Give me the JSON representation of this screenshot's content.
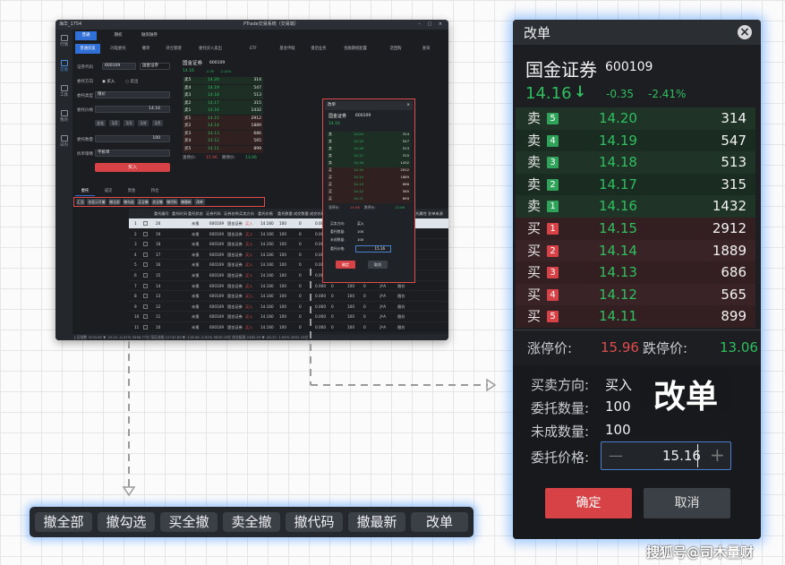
{
  "mini_window": {
    "title": "PTrade交易系统（交易端）",
    "user": "海华_1754",
    "nav": [
      "行情",
      "交易",
      "工具",
      "我的",
      "日内"
    ],
    "top_tabs": [
      "普通",
      "期权",
      "融资融券"
    ],
    "sub_tabs": [
      "普通买卖",
      "闪电委托",
      "撤单",
      "持仓管理",
      "委托买入卖出",
      "ETF",
      "基金申赎",
      "盘后业务",
      "金融期权配置",
      "逆回购",
      "查询"
    ],
    "form": {
      "code_label": "证券代码",
      "code_value": "600109",
      "name_value": "国金证券",
      "direction_label": "委托方向",
      "buy_option": "买入",
      "sell_option": "卖出",
      "type_label": "委托类型",
      "type_value": "限价",
      "price_label": "委托价格",
      "price_value": "14.16",
      "qty_label": "委托数量",
      "qty_value": "100",
      "strategy_label": "拆单策略",
      "strategy_value": "不拆单",
      "fractions": [
        "全仓",
        "1/2",
        "1/3",
        "1/4",
        "1/5"
      ],
      "submit_label": "买入"
    },
    "quote": {
      "name": "国金证券",
      "code": "600109",
      "price": "14.16",
      "change": "-0.35",
      "pct": "-2.41%",
      "sell_rows": [
        {
          "side": "卖5",
          "price": "14.20",
          "vol": "314"
        },
        {
          "side": "卖4",
          "price": "14.19",
          "vol": "547"
        },
        {
          "side": "卖3",
          "price": "14.18",
          "vol": "513"
        },
        {
          "side": "卖2",
          "price": "14.17",
          "vol": "315"
        },
        {
          "side": "卖1",
          "price": "14.16",
          "vol": "1432"
        }
      ],
      "buy_rows": [
        {
          "side": "买1",
          "price": "14.15",
          "vol": "2912"
        },
        {
          "side": "买2",
          "price": "14.14",
          "vol": "1889"
        },
        {
          "side": "买3",
          "price": "14.13",
          "vol": "686"
        },
        {
          "side": "买4",
          "price": "14.12",
          "vol": "565"
        },
        {
          "side": "买5",
          "price": "14.11",
          "vol": "899"
        }
      ],
      "limit_up_label": "涨停价:",
      "limit_up": "15.96",
      "limit_down_label": "跌停价:",
      "limit_down": "13.06"
    },
    "bottom_tabs": [
      "委托",
      "成交",
      "资金",
      "持仓"
    ],
    "toolbar": [
      "汇总",
      "仅显示可撤",
      "撤全部",
      "撤勾选",
      "买全撤",
      "卖全撤",
      "撤代码",
      "撤最新",
      "改单"
    ],
    "columns": [
      "委托编号",
      "委托时间",
      "委托状态",
      "证券代码",
      "证券名称",
      "买卖方向",
      "委托价格",
      "委托数量",
      "成交数量",
      "成交价格",
      "撤单数量",
      "未成数量",
      "撤单原因",
      "挂单数量",
      "证券市场",
      "委托属性",
      "发单来源"
    ],
    "orders": [
      {
        "no": "1",
        "id": "20",
        "status": "未报",
        "code": "600109",
        "name": "国金证券",
        "dir": "买入",
        "price": "14.160",
        "qty": "100",
        "filled": "0",
        "fprice": "0.000",
        "cancel": "0",
        "rest": "100",
        "pending": "0",
        "market": "沪A",
        "attr": "限价"
      },
      {
        "no": "2",
        "id": "19",
        "status": "未报",
        "code": "600109",
        "name": "国金证券",
        "dir": "买入",
        "price": "14.160",
        "qty": "100",
        "filled": "0",
        "fprice": "0.000",
        "cancel": "0",
        "rest": "100",
        "pending": "0",
        "market": "沪A",
        "attr": "限价"
      },
      {
        "no": "3",
        "id": "18",
        "status": "未报",
        "code": "600109",
        "name": "国金证券",
        "dir": "买入",
        "price": "14.160",
        "qty": "100",
        "filled": "0",
        "fprice": "0.000",
        "cancel": "0",
        "rest": "100",
        "pending": "0",
        "market": "沪A",
        "attr": "限价"
      },
      {
        "no": "4",
        "id": "17",
        "status": "未报",
        "code": "600109",
        "name": "国金证券",
        "dir": "买入",
        "price": "14.160",
        "qty": "100",
        "filled": "0",
        "fprice": "0.000",
        "cancel": "0",
        "rest": "100",
        "pending": "0",
        "market": "沪A",
        "attr": "限价"
      },
      {
        "no": "5",
        "id": "16",
        "status": "未报",
        "code": "600109",
        "name": "国金证券",
        "dir": "买入",
        "price": "14.160",
        "qty": "100",
        "filled": "0",
        "fprice": "0.000",
        "cancel": "0",
        "rest": "100",
        "pending": "0",
        "market": "沪A",
        "attr": "限价"
      },
      {
        "no": "6",
        "id": "15",
        "status": "未报",
        "code": "600109",
        "name": "国金证券",
        "dir": "买入",
        "price": "14.160",
        "qty": "100",
        "filled": "0",
        "fprice": "0.000",
        "cancel": "0",
        "rest": "100",
        "pending": "0",
        "market": "沪A",
        "attr": "限价"
      },
      {
        "no": "7",
        "id": "14",
        "status": "未报",
        "code": "600109",
        "name": "国金证券",
        "dir": "买入",
        "price": "14.160",
        "qty": "100",
        "filled": "0",
        "fprice": "0.000",
        "cancel": "0",
        "rest": "100",
        "pending": "0",
        "market": "沪A",
        "attr": "限价"
      },
      {
        "no": "8",
        "id": "13",
        "status": "未报",
        "code": "600109",
        "name": "国金证券",
        "dir": "买入",
        "price": "14.160",
        "qty": "100",
        "filled": "0",
        "fprice": "0.000",
        "cancel": "0",
        "rest": "100",
        "pending": "0",
        "market": "沪A",
        "attr": "限价"
      },
      {
        "no": "9",
        "id": "12",
        "status": "未报",
        "code": "600109",
        "name": "国金证券",
        "dir": "买入",
        "price": "14.160",
        "qty": "100",
        "filled": "0",
        "fprice": "0.000",
        "cancel": "0",
        "rest": "100",
        "pending": "0",
        "market": "沪A",
        "attr": "限价"
      },
      {
        "no": "10",
        "id": "11",
        "status": "未报",
        "code": "600109",
        "name": "国金证券",
        "dir": "买入",
        "price": "14.160",
        "qty": "100",
        "filled": "0",
        "fprice": "0.000",
        "cancel": "0",
        "rest": "100",
        "pending": "0",
        "market": "沪A",
        "attr": "限价"
      },
      {
        "no": "11",
        "id": "10",
        "status": "未报",
        "code": "600109",
        "name": "国金证券",
        "dir": "买入",
        "price": "14.160",
        "qty": "100",
        "filled": "0",
        "fprice": "0.000",
        "cancel": "0",
        "rest": "100",
        "pending": "0",
        "market": "沪A",
        "attr": "限价"
      }
    ],
    "status_bar": "上证指数 3234.82 ▼ -15.21 -0.47% 3096.77亿  深证成指 12742.85 ▼ -118.96 -0.92% 5635.29亿  创业板指 2483.03 ▼ -40.37 -1.60% 2832.24亿"
  },
  "toolbar": {
    "buttons": [
      "撤全部",
      "撤勾选",
      "买全撤",
      "卖全撤",
      "撤代码",
      "撤最新",
      "改单"
    ]
  },
  "dialog": {
    "title": "改单",
    "stock_name": "国金证券",
    "stock_code": "600109",
    "price": "14.16",
    "arrow": "↓",
    "change": "-0.35",
    "pct": "-2.41%",
    "sell_rows": [
      {
        "side": "卖",
        "level": "5",
        "price": "14.20",
        "vol": "314"
      },
      {
        "side": "卖",
        "level": "4",
        "price": "14.19",
        "vol": "547"
      },
      {
        "side": "卖",
        "level": "3",
        "price": "14.18",
        "vol": "513"
      },
      {
        "side": "卖",
        "level": "2",
        "price": "14.17",
        "vol": "315"
      },
      {
        "side": "卖",
        "level": "1",
        "price": "14.16",
        "vol": "1432"
      }
    ],
    "buy_rows": [
      {
        "side": "买",
        "level": "1",
        "price": "14.15",
        "vol": "2912"
      },
      {
        "side": "买",
        "level": "2",
        "price": "14.14",
        "vol": "1889"
      },
      {
        "side": "买",
        "level": "3",
        "price": "14.13",
        "vol": "686"
      },
      {
        "side": "买",
        "level": "4",
        "price": "14.12",
        "vol": "565"
      },
      {
        "side": "买",
        "level": "5",
        "price": "14.11",
        "vol": "899"
      }
    ],
    "limit_up_label": "涨停价:",
    "limit_up": "15.96",
    "limit_down_label": "跌停价:",
    "limit_down": "13.06",
    "direction_label": "买卖方向:",
    "direction": "买入",
    "qty_label": "委托数量:",
    "qty": "100",
    "unfilled_label": "未成数量:",
    "unfilled": "100",
    "price_label": "委托价格:",
    "price_input": "15.16",
    "minus": "—",
    "plus": "+",
    "confirm": "确定",
    "cancel": "取消",
    "close": "×"
  },
  "callout_label": "改单",
  "watermark": "搜狐号@司木量财",
  "colors": {
    "up": "#e04c4c",
    "down": "#2fbf5f",
    "accent": "#2f6fd6",
    "glow": "#5aa0ff"
  },
  "icons": [
    "close-icon",
    "down-arrow-icon",
    "minus-icon",
    "plus-icon",
    "dashed-arrow-icon"
  ]
}
